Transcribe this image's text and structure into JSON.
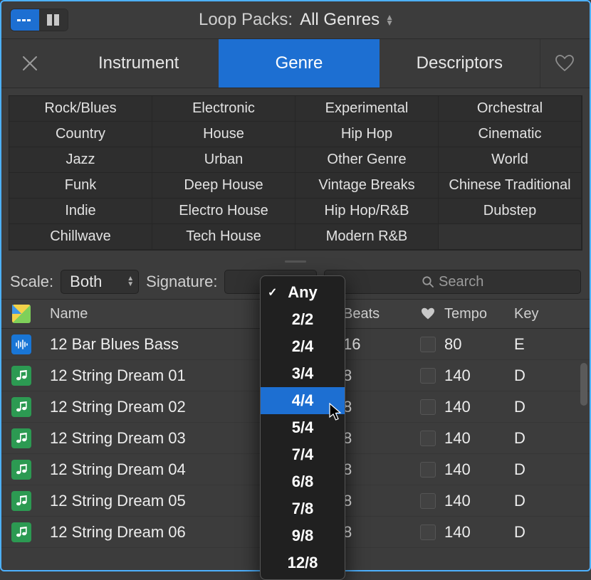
{
  "header": {
    "loop_packs_label": "Loop Packs:",
    "loop_packs_value": "All Genres"
  },
  "tabs": {
    "instrument": "Instrument",
    "genre": "Genre",
    "descriptors": "Descriptors"
  },
  "genres": [
    [
      "Rock/Blues",
      "Electronic",
      "Experimental",
      "Orchestral"
    ],
    [
      "Country",
      "House",
      "Hip Hop",
      "Cinematic"
    ],
    [
      "Jazz",
      "Urban",
      "Other Genre",
      "World"
    ],
    [
      "Funk",
      "Deep House",
      "Vintage Breaks",
      "Chinese Traditional"
    ],
    [
      "Indie",
      "Electro House",
      "Hip Hop/R&B",
      "Dubstep"
    ],
    [
      "Chillwave",
      "Tech House",
      "Modern R&B",
      ""
    ]
  ],
  "filters": {
    "scale_label": "Scale:",
    "scale_value": "Both",
    "signature_label": "Signature:"
  },
  "search": {
    "placeholder": "Search"
  },
  "signature_menu": {
    "items": [
      "Any",
      "2/2",
      "2/4",
      "3/4",
      "4/4",
      "5/4",
      "7/4",
      "6/8",
      "7/8",
      "9/8",
      "12/8"
    ],
    "checked": "Any",
    "highlighted": "4/4"
  },
  "columns": {
    "name": "Name",
    "beats": "Beats",
    "tempo": "Tempo",
    "key": "Key"
  },
  "loops": [
    {
      "icon": "audio",
      "name": "12 Bar Blues Bass",
      "beats": "16",
      "tempo": "80",
      "key": "E"
    },
    {
      "icon": "midi",
      "name": "12 String Dream 01",
      "beats": "8",
      "tempo": "140",
      "key": "D"
    },
    {
      "icon": "midi",
      "name": "12 String Dream 02",
      "beats": "8",
      "tempo": "140",
      "key": "D"
    },
    {
      "icon": "midi",
      "name": "12 String Dream 03",
      "beats": "8",
      "tempo": "140",
      "key": "D"
    },
    {
      "icon": "midi",
      "name": "12 String Dream 04",
      "beats": "8",
      "tempo": "140",
      "key": "D"
    },
    {
      "icon": "midi",
      "name": "12 String Dream 05",
      "beats": "8",
      "tempo": "140",
      "key": "D"
    },
    {
      "icon": "midi",
      "name": "12 String Dream 06",
      "beats": "8",
      "tempo": "140",
      "key": "D"
    }
  ]
}
